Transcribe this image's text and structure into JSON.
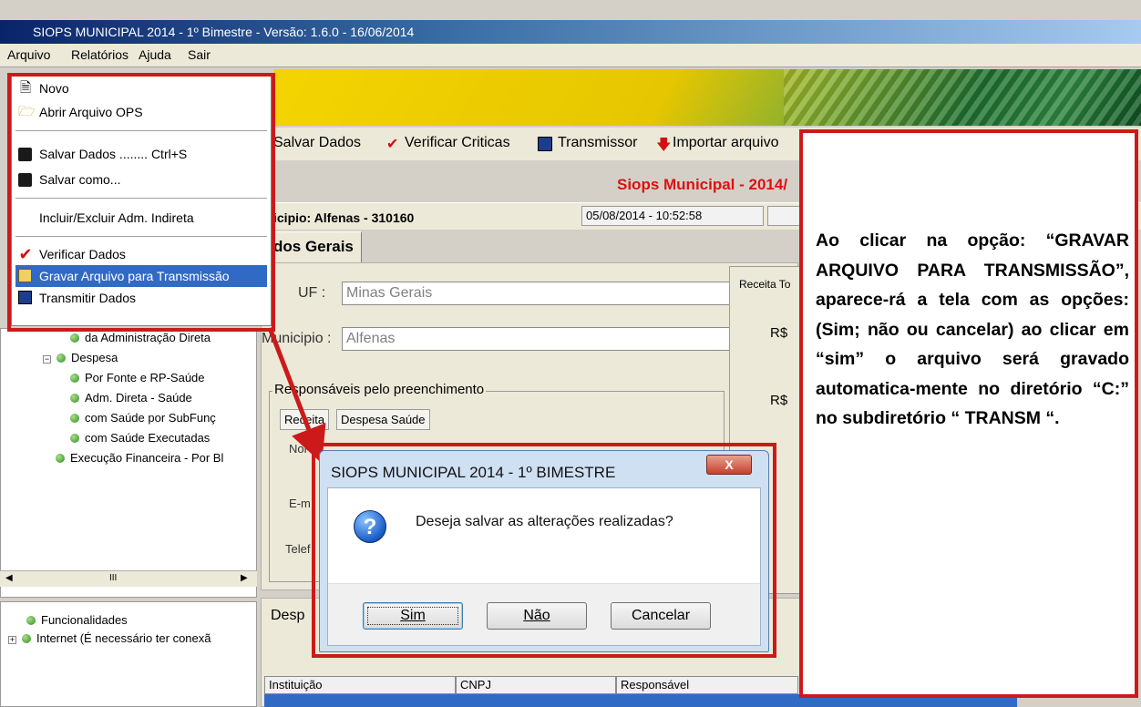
{
  "window": {
    "title": "SIOPS MUNICIPAL 2014 - 1º Bimestre - Versão: 1.6.0 - 16/06/2014"
  },
  "menubar": {
    "items": [
      "Arquivo",
      "Relatórios",
      "Ajuda",
      "Sair"
    ]
  },
  "file_menu": {
    "items": [
      {
        "label": "Novo",
        "icon": "new-document-icon"
      },
      {
        "label": "Abrir Arquivo OPS",
        "icon": "open-folder-icon"
      },
      {
        "label": "Salvar Dados ........ Ctrl+S",
        "icon": "floppy-disk-icon"
      },
      {
        "label": "Salvar como...",
        "icon": "floppy-disk-icon"
      },
      {
        "label": "Incluir/Excluir Adm. Indireta",
        "icon": ""
      },
      {
        "label": "Verificar Dados",
        "icon": "red-check-icon"
      },
      {
        "label": "Gravar Arquivo para Transmissão",
        "icon": "record-file-icon"
      },
      {
        "label": "Transmitir Dados",
        "icon": "transmit-icon"
      }
    ],
    "selected": "Gravar Arquivo para Transmissão"
  },
  "toolbar": {
    "items": [
      "Salvar Dados",
      "Verificar Criticas",
      "Transmissor",
      "Importar arquivo"
    ]
  },
  "header": {
    "red_title": "Siops Municipal - 2014/",
    "municipio_info": "icipio: Alfenas - 310160",
    "datetime": "05/08/2014 - 10:52:58",
    "tab_label": "dos Gerais"
  },
  "form": {
    "uf_label": "UF :",
    "uf_value": "Minas Gerais",
    "municipio_label": "Municipio :",
    "municipio_value": "Alfenas",
    "group_title": "Responsáveis pelo preenchimento",
    "tabs": [
      "Receita",
      "Despesa Saúde"
    ],
    "field_labels": [
      "Nor",
      "E-m",
      "Telef"
    ],
    "right_label": "Receita To",
    "currency_1": "R$",
    "currency_2": "R$"
  },
  "tree": {
    "items": [
      "da Administração Direta",
      "Despesa",
      "Por Fonte e RP-Saúde",
      "Adm. Direta - Saúde",
      "com Saúde por SubFunç",
      "com Saúde Executadas",
      "Execução Financeira - Por Bl"
    ],
    "scroll_mark": "III"
  },
  "tree_bottom": {
    "items": [
      "Funcionalidades",
      "Internet (É necessário ter conexã"
    ]
  },
  "bottom_panel": {
    "label": "Desp",
    "columns": [
      "Instituição",
      "CNPJ",
      "Responsável"
    ]
  },
  "dialog": {
    "title": "SIOPS MUNICIPAL 2014 - 1º BIMESTRE",
    "close_label": "X",
    "message": "Deseja salvar as alterações realizadas?",
    "buttons": [
      "Sim",
      "Não",
      "Cancelar"
    ],
    "icon": "question-icon"
  },
  "callout": {
    "text": "Ao clicar na opção: “GRAVAR ARQUIVO PARA TRANSMISSÃO”, aparece-rá a tela com as opções: (Sim; não ou cancelar) ao clicar em “sim” o arquivo será gravado automatica-mente no diretório “C:” no subdiretório “ TRANSM “."
  },
  "colors": {
    "annotation_red": "#cc1a1a",
    "selection_blue": "#316ac5",
    "title_red": "#e01010"
  }
}
